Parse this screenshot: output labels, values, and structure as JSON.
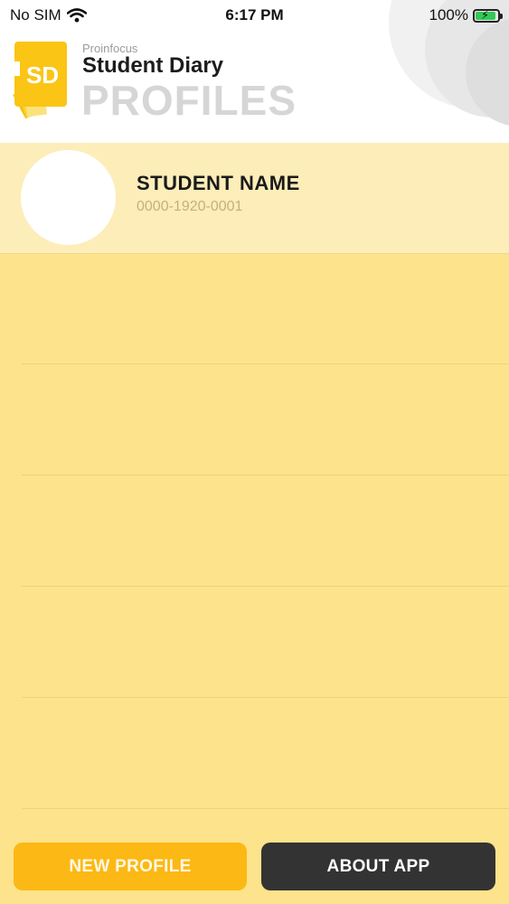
{
  "status_bar": {
    "carrier": "No SIM",
    "time": "6:17 PM",
    "battery_percent": "100%",
    "battery_level": 1.0,
    "battery_color": "#34c759"
  },
  "header": {
    "logo_text": "SD",
    "brand_small": "Proinfocus",
    "brand_title": "Student Diary",
    "page_heading": "PROFILES"
  },
  "profiles": [
    {
      "name": "STUDENT NAME",
      "id": "0000-1920-0001"
    }
  ],
  "footer": {
    "new_profile_label": "NEW PROFILE",
    "about_app_label": "ABOUT APP"
  },
  "colors": {
    "accent": "#fcb814",
    "background": "#fde38b",
    "dark_button": "#333333"
  },
  "icons": [
    "wifi-icon",
    "battery-icon",
    "charging-bolt-icon",
    "app-logo-icon"
  ]
}
